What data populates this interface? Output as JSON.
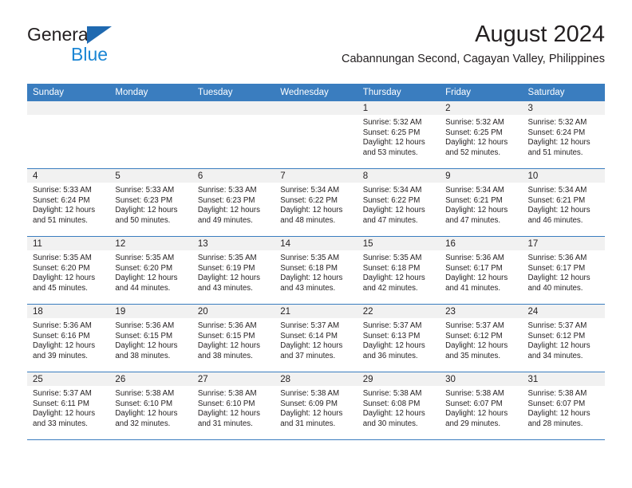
{
  "brand": {
    "name_top": "General",
    "name_bottom": "Blue",
    "triangle_color": "#1f69b0",
    "blue_text_color": "#1c86d4"
  },
  "header": {
    "title": "August 2024",
    "location": "Cabannungan Second, Cagayan Valley, Philippines"
  },
  "theme": {
    "header_blue": "#3a7dbf",
    "cell_band_gray": "#f1f1f1",
    "text": "#231f20"
  },
  "weekdays": [
    "Sunday",
    "Monday",
    "Tuesday",
    "Wednesday",
    "Thursday",
    "Friday",
    "Saturday"
  ],
  "labels": {
    "sunrise_prefix": "Sunrise:",
    "sunset_prefix": "Sunset:",
    "daylight_prefix": "Daylight:"
  },
  "weeks": [
    [
      {
        "empty": true
      },
      {
        "empty": true
      },
      {
        "empty": true
      },
      {
        "empty": true
      },
      {
        "day": "1",
        "sunrise": "Sunrise: 5:32 AM",
        "sunset": "Sunset: 6:25 PM",
        "daylight": "Daylight: 12 hours and 53 minutes."
      },
      {
        "day": "2",
        "sunrise": "Sunrise: 5:32 AM",
        "sunset": "Sunset: 6:25 PM",
        "daylight": "Daylight: 12 hours and 52 minutes."
      },
      {
        "day": "3",
        "sunrise": "Sunrise: 5:32 AM",
        "sunset": "Sunset: 6:24 PM",
        "daylight": "Daylight: 12 hours and 51 minutes."
      }
    ],
    [
      {
        "day": "4",
        "sunrise": "Sunrise: 5:33 AM",
        "sunset": "Sunset: 6:24 PM",
        "daylight": "Daylight: 12 hours and 51 minutes."
      },
      {
        "day": "5",
        "sunrise": "Sunrise: 5:33 AM",
        "sunset": "Sunset: 6:23 PM",
        "daylight": "Daylight: 12 hours and 50 minutes."
      },
      {
        "day": "6",
        "sunrise": "Sunrise: 5:33 AM",
        "sunset": "Sunset: 6:23 PM",
        "daylight": "Daylight: 12 hours and 49 minutes."
      },
      {
        "day": "7",
        "sunrise": "Sunrise: 5:34 AM",
        "sunset": "Sunset: 6:22 PM",
        "daylight": "Daylight: 12 hours and 48 minutes."
      },
      {
        "day": "8",
        "sunrise": "Sunrise: 5:34 AM",
        "sunset": "Sunset: 6:22 PM",
        "daylight": "Daylight: 12 hours and 47 minutes."
      },
      {
        "day": "9",
        "sunrise": "Sunrise: 5:34 AM",
        "sunset": "Sunset: 6:21 PM",
        "daylight": "Daylight: 12 hours and 47 minutes."
      },
      {
        "day": "10",
        "sunrise": "Sunrise: 5:34 AM",
        "sunset": "Sunset: 6:21 PM",
        "daylight": "Daylight: 12 hours and 46 minutes."
      }
    ],
    [
      {
        "day": "11",
        "sunrise": "Sunrise: 5:35 AM",
        "sunset": "Sunset: 6:20 PM",
        "daylight": "Daylight: 12 hours and 45 minutes."
      },
      {
        "day": "12",
        "sunrise": "Sunrise: 5:35 AM",
        "sunset": "Sunset: 6:20 PM",
        "daylight": "Daylight: 12 hours and 44 minutes."
      },
      {
        "day": "13",
        "sunrise": "Sunrise: 5:35 AM",
        "sunset": "Sunset: 6:19 PM",
        "daylight": "Daylight: 12 hours and 43 minutes."
      },
      {
        "day": "14",
        "sunrise": "Sunrise: 5:35 AM",
        "sunset": "Sunset: 6:18 PM",
        "daylight": "Daylight: 12 hours and 43 minutes."
      },
      {
        "day": "15",
        "sunrise": "Sunrise: 5:35 AM",
        "sunset": "Sunset: 6:18 PM",
        "daylight": "Daylight: 12 hours and 42 minutes."
      },
      {
        "day": "16",
        "sunrise": "Sunrise: 5:36 AM",
        "sunset": "Sunset: 6:17 PM",
        "daylight": "Daylight: 12 hours and 41 minutes."
      },
      {
        "day": "17",
        "sunrise": "Sunrise: 5:36 AM",
        "sunset": "Sunset: 6:17 PM",
        "daylight": "Daylight: 12 hours and 40 minutes."
      }
    ],
    [
      {
        "day": "18",
        "sunrise": "Sunrise: 5:36 AM",
        "sunset": "Sunset: 6:16 PM",
        "daylight": "Daylight: 12 hours and 39 minutes."
      },
      {
        "day": "19",
        "sunrise": "Sunrise: 5:36 AM",
        "sunset": "Sunset: 6:15 PM",
        "daylight": "Daylight: 12 hours and 38 minutes."
      },
      {
        "day": "20",
        "sunrise": "Sunrise: 5:36 AM",
        "sunset": "Sunset: 6:15 PM",
        "daylight": "Daylight: 12 hours and 38 minutes."
      },
      {
        "day": "21",
        "sunrise": "Sunrise: 5:37 AM",
        "sunset": "Sunset: 6:14 PM",
        "daylight": "Daylight: 12 hours and 37 minutes."
      },
      {
        "day": "22",
        "sunrise": "Sunrise: 5:37 AM",
        "sunset": "Sunset: 6:13 PM",
        "daylight": "Daylight: 12 hours and 36 minutes."
      },
      {
        "day": "23",
        "sunrise": "Sunrise: 5:37 AM",
        "sunset": "Sunset: 6:12 PM",
        "daylight": "Daylight: 12 hours and 35 minutes."
      },
      {
        "day": "24",
        "sunrise": "Sunrise: 5:37 AM",
        "sunset": "Sunset: 6:12 PM",
        "daylight": "Daylight: 12 hours and 34 minutes."
      }
    ],
    [
      {
        "day": "25",
        "sunrise": "Sunrise: 5:37 AM",
        "sunset": "Sunset: 6:11 PM",
        "daylight": "Daylight: 12 hours and 33 minutes."
      },
      {
        "day": "26",
        "sunrise": "Sunrise: 5:38 AM",
        "sunset": "Sunset: 6:10 PM",
        "daylight": "Daylight: 12 hours and 32 minutes."
      },
      {
        "day": "27",
        "sunrise": "Sunrise: 5:38 AM",
        "sunset": "Sunset: 6:10 PM",
        "daylight": "Daylight: 12 hours and 31 minutes."
      },
      {
        "day": "28",
        "sunrise": "Sunrise: 5:38 AM",
        "sunset": "Sunset: 6:09 PM",
        "daylight": "Daylight: 12 hours and 31 minutes."
      },
      {
        "day": "29",
        "sunrise": "Sunrise: 5:38 AM",
        "sunset": "Sunset: 6:08 PM",
        "daylight": "Daylight: 12 hours and 30 minutes."
      },
      {
        "day": "30",
        "sunrise": "Sunrise: 5:38 AM",
        "sunset": "Sunset: 6:07 PM",
        "daylight": "Daylight: 12 hours and 29 minutes."
      },
      {
        "day": "31",
        "sunrise": "Sunrise: 5:38 AM",
        "sunset": "Sunset: 6:07 PM",
        "daylight": "Daylight: 12 hours and 28 minutes."
      }
    ]
  ]
}
